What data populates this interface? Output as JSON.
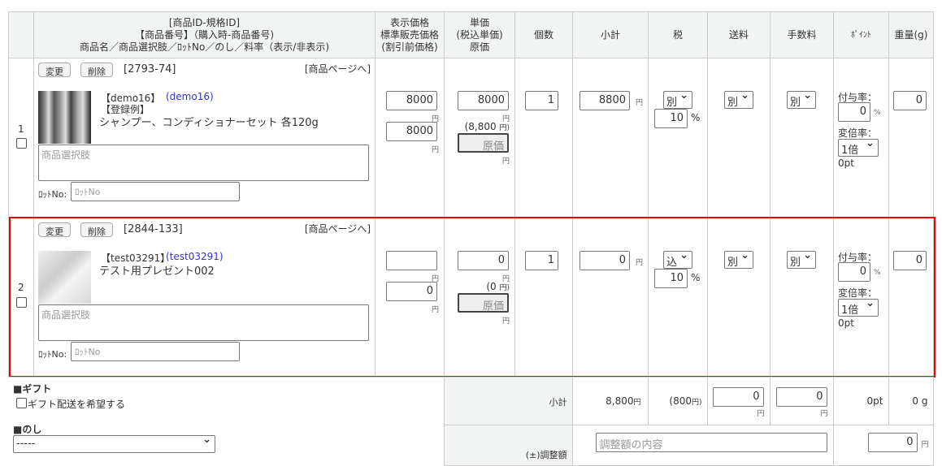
{
  "header": {
    "col_product": [
      "[商品ID-規格ID]",
      "【商品番号】（購入時-商品番号)",
      "商品名／商品選択肢／ﾛｯﾄNo／のし／料率（表示/非表示)"
    ],
    "col_price": [
      "表示価格",
      "標準販売価格",
      "(割引前価格)"
    ],
    "col_unit": [
      "単価",
      "(税込単価)",
      "原価"
    ],
    "col_qty": "個数",
    "col_subtotal": "小計",
    "col_tax": "税",
    "col_shipping": "送料",
    "col_fee": "手数料",
    "col_point": "ﾎﾟｲﾝﾄ",
    "col_weight": "重量(g)"
  },
  "rows": [
    {
      "no": "1",
      "change": "変更",
      "delete": "削除",
      "id": "[2793-74]",
      "page_link": "[商品ページへ]",
      "code": "【demo16】",
      "code_purchase": "(demo16)",
      "note": "【登録例】",
      "name": "シャンプー、コンディショナーセット 各120g",
      "option_placeholder": "商品選択肢",
      "lot_label": "ﾛｯﾄNo:",
      "lot_placeholder": "ﾛｯﾄNo",
      "display_price": "8000",
      "std_price": "8000",
      "unit_price": "8000",
      "tax_incl": "(8,800",
      "cost_placeholder": "原価",
      "qty": "1",
      "subtotal": "8800",
      "tax_sel": "別",
      "tax_rate": "10",
      "ship_sel": "別",
      "fee_sel": "別",
      "grant_label": "付与率：",
      "grant": "0",
      "mult_label": "変倍率：",
      "mult": "1倍",
      "pt": "0pt",
      "weight": "0"
    },
    {
      "no": "2",
      "change": "変更",
      "delete": "削除",
      "id": "[2844-133]",
      "page_link": "[商品ページへ]",
      "code": "【test03291】",
      "code_purchase": "(test03291)",
      "note": "",
      "name": "テスト用プレゼント002",
      "option_placeholder": "商品選択肢",
      "lot_label": "ﾛｯﾄNo:",
      "lot_placeholder": "ﾛｯﾄNo",
      "display_price": "",
      "std_price": "0",
      "unit_price": "0",
      "tax_incl": "(0",
      "cost_placeholder": "原価",
      "qty": "1",
      "subtotal": "0",
      "tax_sel": "込",
      "tax_rate": "10",
      "ship_sel": "別",
      "fee_sel": "別",
      "grant_label": "付与率：",
      "grant": "0",
      "mult_label": "変倍率：",
      "mult": "1倍",
      "pt": "0pt",
      "weight": "0"
    }
  ],
  "yen": "円",
  "yen_paren": "円)",
  "pct": "%",
  "gift": {
    "title": "■ギフト",
    "checkbox": "ギフト配送を希望する"
  },
  "noshi": {
    "title": "■のし",
    "value": "-----"
  },
  "summary": {
    "label": "小計",
    "subtotal": "8,800",
    "tax": "(800",
    "shipping": "0",
    "fee": "0",
    "pt": "0pt",
    "weight": "0 g"
  },
  "adjust": {
    "label": "(±)調整額",
    "placeholder": "調整額の内容",
    "value": "0"
  },
  "colors": {
    "highlight": "#e00000",
    "link": "#3333cc"
  }
}
